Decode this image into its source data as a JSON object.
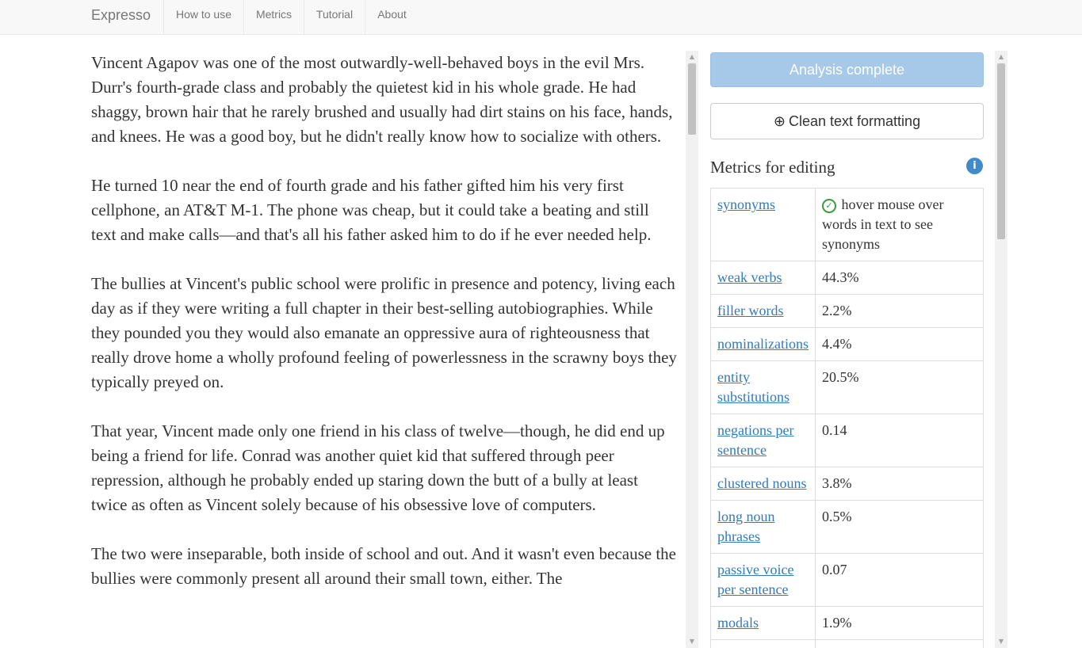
{
  "navbar": {
    "brand": "Expresso",
    "items": [
      "How to use",
      "Metrics",
      "Tutorial",
      "About"
    ]
  },
  "text": {
    "paragraphs": [
      "Vincent Agapov was one of the most outwardly-well-behaved boys in the evil Mrs. Durr's fourth-grade class and probably the quietest kid in his whole grade. He had shaggy, brown hair that he rarely brushed and usually had dirt stains on his face, hands, and knees. He was a good boy, but he didn't really know how to socialize with others.",
      "He turned 10 near the end of fourth grade and his father gifted him his very first cellphone, an AT&T M-1. The phone was cheap, but it could take a beating and still text and make calls—and that's all his father asked him to do if he ever needed help.",
      "The bullies at Vincent's public school were prolific in presence and potency, living each day as if they were writing a full chapter in their best-selling autobiographies. While they pounded you they would also emanate an oppressive aura of righteousness that really drove home a wholly profound feeling of powerlessness in the scrawny boys they typically preyed on.",
      "That year, Vincent made only one friend in his class of twelve—though, he did end up being a friend for life. Conrad was another quiet kid that suffered through peer repression, although he probably ended up staring down the butt of a bully at least twice as often as Vincent solely because of his obsessive love of computers.",
      "The two were inseparable, both inside of school and out. And it wasn't even because the bullies were commonly present all around their small town, either. The"
    ]
  },
  "side": {
    "status_button": "Analysis complete",
    "clean_button": "Clean text formatting",
    "metrics_title": "Metrics for editing",
    "synonyms_hint": "hover mouse over words in text to see synonyms",
    "metrics": [
      {
        "name": "synonyms",
        "value": ""
      },
      {
        "name": "weak verbs",
        "value": "44.3%"
      },
      {
        "name": "filler words",
        "value": "2.2%"
      },
      {
        "name": "nominalizations",
        "value": "4.4%"
      },
      {
        "name": "entity substitutions",
        "value": "20.5%"
      },
      {
        "name": "negations per sentence",
        "value": "0.14"
      },
      {
        "name": "clustered nouns",
        "value": "3.8%"
      },
      {
        "name": "long noun phrases",
        "value": "0.5%"
      },
      {
        "name": "passive voice per sentence",
        "value": "0.07"
      },
      {
        "name": "modals",
        "value": "1.9%"
      },
      {
        "name": "",
        "value": ""
      }
    ]
  },
  "icons": {
    "clean": "download-circle-icon",
    "info": "info-circle-icon",
    "check": "check-circle-icon"
  },
  "colors": {
    "link": "#337ab7",
    "status_button_bg": "#a6c8e9",
    "info_icon": "#428bca",
    "check_icon": "#3c9a3c"
  }
}
